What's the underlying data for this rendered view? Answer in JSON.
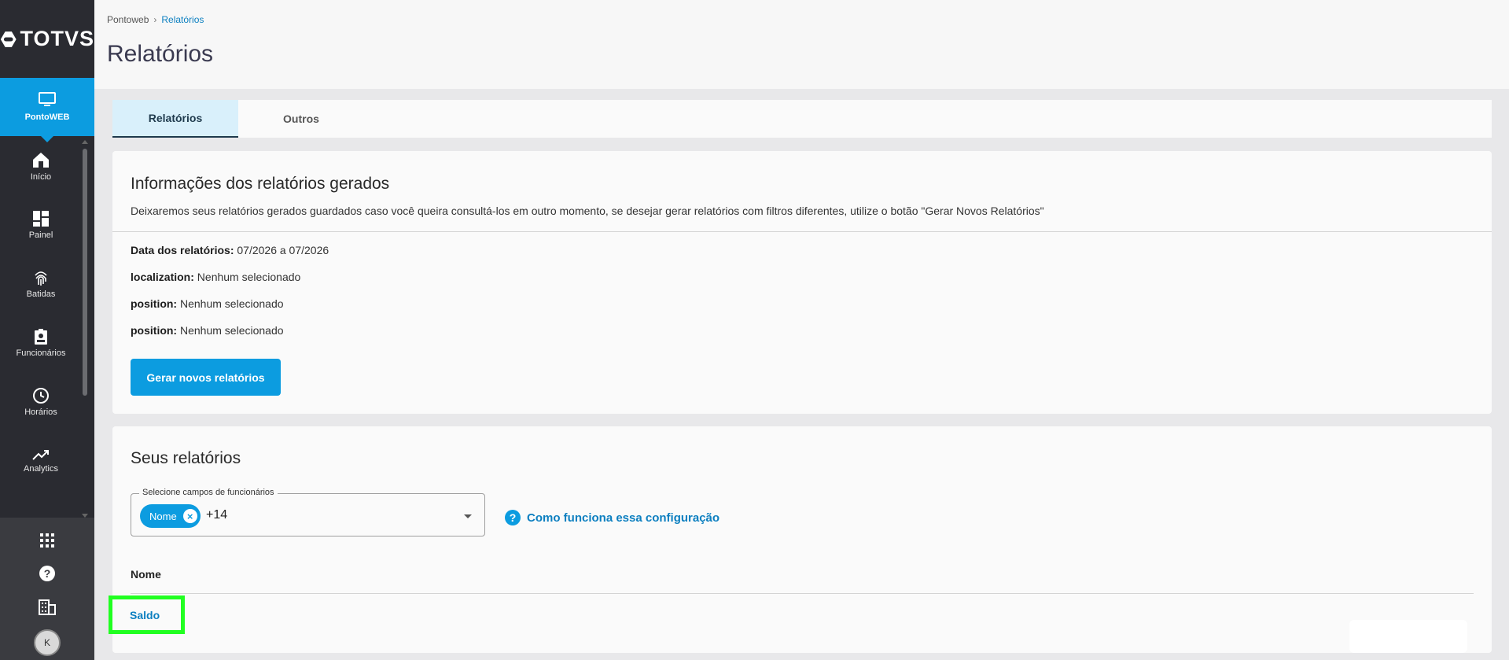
{
  "brand": {
    "logo_text": "TOTVS"
  },
  "sidebar": {
    "active": {
      "label": "PontoWEB",
      "icon": "monitor-icon"
    },
    "items": [
      {
        "label": "Início",
        "icon": "home-icon"
      },
      {
        "label": "Painel",
        "icon": "dashboard-icon"
      },
      {
        "label": "Batidas",
        "icon": "fingerprint-icon"
      },
      {
        "label": "Funcionários",
        "icon": "badge-icon"
      },
      {
        "label": "Horários",
        "icon": "clock-icon"
      },
      {
        "label": "Analytics",
        "icon": "trending-up-icon"
      }
    ],
    "bottom": {
      "apps_icon": "apps-grid-icon",
      "help_icon": "help-icon",
      "company_icon": "building-icon",
      "avatar_initial": "K"
    }
  },
  "breadcrumb": {
    "root": "Pontoweb",
    "current": "Relatórios"
  },
  "page": {
    "title": "Relatórios"
  },
  "tabs": [
    {
      "label": "Relatórios",
      "active": true
    },
    {
      "label": "Outros",
      "active": false
    }
  ],
  "info_card": {
    "title": "Informações dos relatórios gerados",
    "description": "Deixaremos seus relatórios gerados guardados caso você queira consultá-los em outro momento, se desejar gerar relatórios com filtros diferentes, utilize o botão \"Gerar Novos Relatórios\"",
    "lines": [
      {
        "label": "Data dos relatórios:",
        "value": "07/2026 a 07/2026"
      },
      {
        "label": "localization:",
        "value": "Nenhum selecionado"
      },
      {
        "label": "position:",
        "value": "Nenhum selecionado"
      },
      {
        "label": "position:",
        "value": "Nenhum selecionado"
      }
    ],
    "button_label": "Gerar novos relatórios"
  },
  "reports_card": {
    "title": "Seus relatórios",
    "field_label": "Selecione campos de funcionários",
    "chip_label": "Nome",
    "more_count": "+14",
    "help_link": "Como funciona essa configuração",
    "column_header": "Nome",
    "rows": [
      "Saldo"
    ]
  },
  "colors": {
    "primary": "#0c9ce0",
    "sidebar": "#2a2b31",
    "highlight": "#21ff21"
  }
}
